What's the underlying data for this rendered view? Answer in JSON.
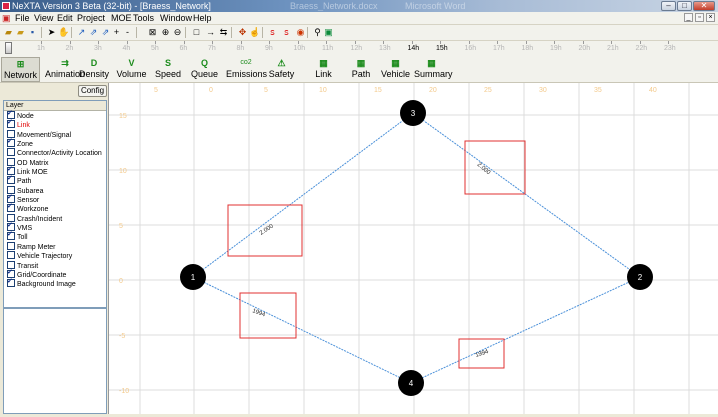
{
  "window": {
    "title": "NeXTA Version 3 Beta (32-bit) - [Braess_Network]",
    "background_title_1": "Braess_Network.docx",
    "background_title_2": "Microsoft Word"
  },
  "menu": {
    "items": [
      "File",
      "View",
      "Edit",
      "Project",
      "MOE",
      "Tools",
      "Window",
      "Help"
    ]
  },
  "timeline": {
    "hours": [
      "1h",
      "2h",
      "3h",
      "4h",
      "5h",
      "6h",
      "7h",
      "8h",
      "9h",
      "10h",
      "11h",
      "12h",
      "13h",
      "14h",
      "15h",
      "16h",
      "17h",
      "18h",
      "19h",
      "20h",
      "21h",
      "22h",
      "23h"
    ],
    "highlighted": [
      "14h",
      "15h"
    ]
  },
  "modes": [
    {
      "icon": "network-icon",
      "glyph": "⊞",
      "label": "Network",
      "active": true
    },
    {
      "icon": "animation-icon",
      "glyph": "⇉",
      "label": "Animation"
    },
    {
      "icon": "density-icon",
      "glyph": "D",
      "label": "Density"
    },
    {
      "icon": "volume-icon",
      "glyph": "V",
      "label": "Volume"
    },
    {
      "icon": "speed-icon",
      "glyph": "S",
      "label": "Speed"
    },
    {
      "icon": "queue-icon",
      "glyph": "Q",
      "label": "Queue"
    },
    {
      "icon": "emissions-icon",
      "glyph": "co2",
      "label": "Emissions"
    },
    {
      "icon": "safety-icon",
      "glyph": "⚠",
      "label": "Safety"
    },
    {
      "icon": "link-icon",
      "glyph": "▦",
      "label": "Link"
    },
    {
      "icon": "path-icon",
      "glyph": "▦",
      "label": "Path"
    },
    {
      "icon": "vehicle-icon",
      "glyph": "▦",
      "label": "Vehicle"
    },
    {
      "icon": "summary-icon",
      "glyph": "▦",
      "label": "Summary"
    }
  ],
  "config_label": "Config",
  "layer_header": "Layer",
  "layers": [
    {
      "label": "Node",
      "checked": true
    },
    {
      "label": "Link",
      "checked": true,
      "color": "#e00000"
    },
    {
      "label": "Movement/Signal",
      "checked": false
    },
    {
      "label": "Zone",
      "checked": true
    },
    {
      "label": "Connector/Activity Location",
      "checked": false
    },
    {
      "label": "OD Matrix",
      "checked": false
    },
    {
      "label": "Link MOE",
      "checked": true
    },
    {
      "label": "Path",
      "checked": true
    },
    {
      "label": "Subarea",
      "checked": false
    },
    {
      "label": "Sensor",
      "checked": true
    },
    {
      "label": "Workzone",
      "checked": true
    },
    {
      "label": "Crash/Incident",
      "checked": false
    },
    {
      "label": "VMS",
      "checked": true
    },
    {
      "label": "Toll",
      "checked": true
    },
    {
      "label": "Ramp Meter",
      "checked": false
    },
    {
      "label": "Vehicle Trajectory",
      "checked": false
    },
    {
      "label": "Transit",
      "checked": false
    },
    {
      "label": "Grid/Coordinate",
      "checked": true
    },
    {
      "label": "Background Image",
      "checked": true
    }
  ],
  "map": {
    "grid_x_labels": [
      "5",
      "0",
      "5",
      "10",
      "15",
      "20",
      "25",
      "30",
      "35",
      "40"
    ],
    "grid_y_labels": [
      "15",
      "10",
      "5",
      "0",
      "-5",
      "-10"
    ],
    "nodes": [
      {
        "id": "1",
        "label": "1"
      },
      {
        "id": "2",
        "label": "2"
      },
      {
        "id": "3",
        "label": "3"
      },
      {
        "id": "4",
        "label": "4"
      }
    ],
    "link_labels": [
      "2.000",
      "2.000",
      "1994",
      "1994"
    ],
    "colors": {
      "grid": "#dcdcdc",
      "grid_label": "#f3c98a",
      "link": "#4a90d9",
      "box": "#e03030",
      "node": "#000000",
      "node_text": "#ffffff"
    }
  }
}
